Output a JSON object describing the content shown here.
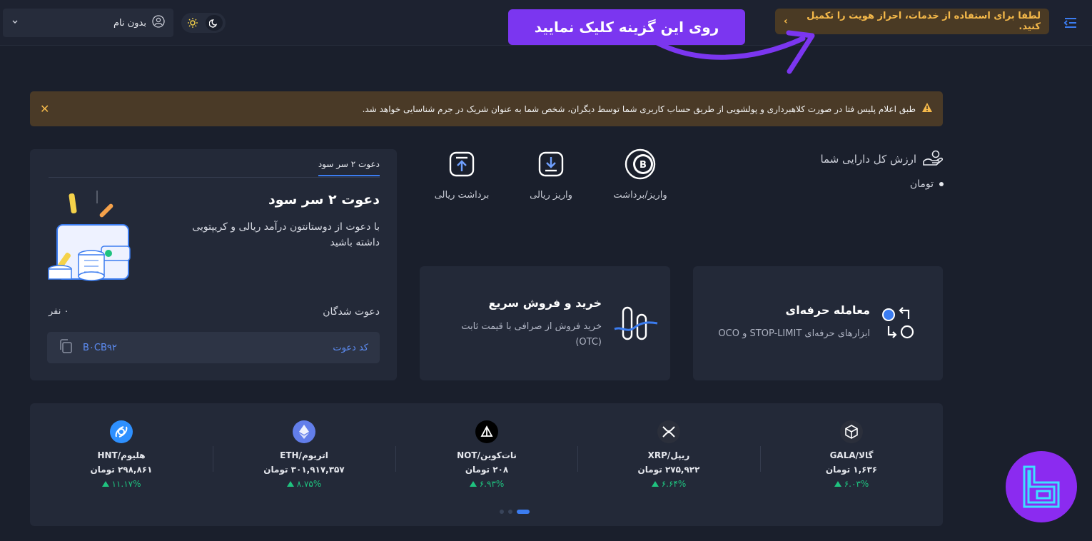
{
  "colors": {
    "background": "#1a1f2c",
    "card": "#232938",
    "accent_blue": "#3b7cf0",
    "warning": "#f5b94a",
    "callout_purple": "#7b36f0",
    "positive": "#1fc27f",
    "logo_purple": "#8b2bf0"
  },
  "header": {
    "menu_icon": "menu-collapse-icon",
    "kyc_notice": "لطفا برای استفاده از خدمات، احراز هویت را تکمیل کنید.",
    "kyc_chevron": "›",
    "callout": "روی این گزینه کلیک نمایید",
    "user_name": "بدون نام",
    "user_dropdown": "⌄"
  },
  "alert": {
    "text": "طبق اعلام پلیس فتا در صورت کلاهبرداری و پولشویی از طریق حساب کاربری شما توسط دیگران، شخص شما به عنوان شریک در جرم شناسایی خواهد شد.",
    "close": "✕"
  },
  "assets": {
    "title": "ارزش کل دارایی شما",
    "value": "تومان"
  },
  "actions": [
    {
      "label": "واریز/برداشت",
      "icon": "crypto-wallet-icon"
    },
    {
      "label": "واریز ریالی",
      "icon": "deposit-icon"
    },
    {
      "label": "برداشت ریالی",
      "icon": "withdraw-icon"
    }
  ],
  "trade_card": {
    "title": "معامله حرفه‌ای",
    "desc": "ابزارهای حرفه‌ای STOP-LIMIT و OCO"
  },
  "otc_card": {
    "title": "خرید و فروش سریع",
    "desc": "خرید فروش از صرافی با قیمت ثابت (OTC)"
  },
  "invite": {
    "tab": "دعوت ۲ سر سود",
    "title": "دعوت ۲ سر سود",
    "desc": "با دعوت از دوستانتون درآمد ریالی و کریپتویی داشته باشید",
    "invited_label": "دعوت شدگان",
    "invited_count": "۰ نفر",
    "code_label": "کد دعوت",
    "code_value": "B۰CB۹۲"
  },
  "ticker": {
    "coins": [
      {
        "name": "GALA/گالا",
        "price": "۱,۶۳۶ تومان",
        "change": "۶.۰۳%",
        "icon": "gala-icon",
        "color": "#2b2f3b"
      },
      {
        "name": "XRP/ریپل",
        "price": "۲۷۵,۹۲۲ تومان",
        "change": "۶.۶۴%",
        "icon": "xrp-icon",
        "color": "#2b2f3b"
      },
      {
        "name": "NOT/نات‌کوین",
        "price": "۲۰۸ تومان",
        "change": "۶.۹۳%",
        "icon": "notcoin-icon",
        "color": "#000000"
      },
      {
        "name": "ETH/اتریوم",
        "price": "۳۰۱,۹۱۷,۳۵۷ تومان",
        "change": "۸.۷۵%",
        "icon": "ethereum-icon",
        "color": "#627eea"
      },
      {
        "name": "HNT/هلیوم",
        "price": "۲۹۸,۸۶۱ تومان",
        "change": "۱۱.۱۷%",
        "icon": "helium-icon",
        "color": "#2e90ff"
      }
    ]
  }
}
